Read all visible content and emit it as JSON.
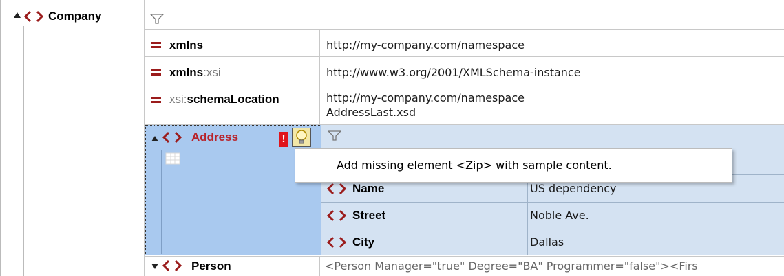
{
  "root": {
    "label": "Company"
  },
  "attributes": [
    {
      "prefix": "",
      "name": "xmlns",
      "suffix": "",
      "value_lines": [
        "http://my-company.com/namespace"
      ]
    },
    {
      "prefix": "",
      "name": "xmlns",
      "suffix": ":xsi",
      "value_lines": [
        "http://www.w3.org/2001/XMLSchema-instance"
      ]
    },
    {
      "prefix": "xsi:",
      "name": "schemaLocation",
      "suffix": "",
      "value_lines": [
        "http://my-company.com/namespace",
        "AddressLast.xsd"
      ]
    }
  ],
  "address": {
    "label": "Address",
    "tooltip": "Add missing element <Zip> with sample content.",
    "children": [
      {
        "name": "Name",
        "value": "US dependency"
      },
      {
        "name": "Street",
        "value": "Noble Ave."
      },
      {
        "name": "City",
        "value": "Dallas"
      }
    ]
  },
  "person": {
    "label": "Person",
    "preview": "<Person Manager=\"true\" Degree=\"BA\" Programmer=\"false\"><Firs"
  },
  "colors": {
    "tag_red": "#9b1c1c",
    "selection_blue": "#a9c9ef",
    "grid_blue": "#d4e2f2"
  },
  "icons": [
    "collapse-triangle-icon",
    "element-tag-icon",
    "attribute-equals-icon",
    "filter-funnel-icon",
    "error-exclamation-icon",
    "lightbulb-icon",
    "table-view-icon",
    "expand-triangle-icon"
  ]
}
